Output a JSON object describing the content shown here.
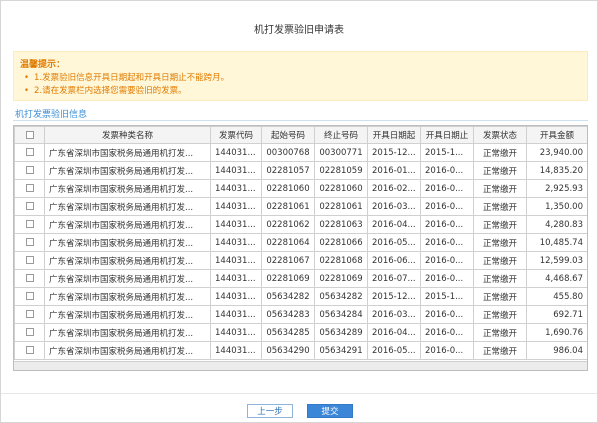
{
  "dialog": {
    "title": "机打发票验旧申请表"
  },
  "notice": {
    "heading": "温馨提示：",
    "items": [
      {
        "bullet": "•",
        "text": "1.发票验旧信息开具日期起和开具日期止不能跨月。"
      },
      {
        "bullet": "•",
        "text": "2.请在发票栏内选择您需要验旧的发票。"
      }
    ]
  },
  "section": {
    "label": "机打发票验旧信息"
  },
  "table": {
    "headers": {
      "type_name": "发票种类名称",
      "code": "发票代码",
      "start_no": "起始号码",
      "end_no": "终止号码",
      "date_from": "开具日期起",
      "date_to": "开具日期止",
      "status": "发票状态",
      "amount": "开具金额"
    },
    "rows": [
      {
        "type_name": "广东省深圳市国家税务局通用机打发...",
        "code": "144031...",
        "start_no": "00300768",
        "end_no": "00300771",
        "date_from": "2015-12...",
        "date_to": "2015-1...",
        "status": "正常缴开",
        "amount": "23,940.00"
      },
      {
        "type_name": "广东省深圳市国家税务局通用机打发...",
        "code": "144031...",
        "start_no": "02281057",
        "end_no": "02281059",
        "date_from": "2016-01...",
        "date_to": "2016-0...",
        "status": "正常缴开",
        "amount": "14,835.20"
      },
      {
        "type_name": "广东省深圳市国家税务局通用机打发...",
        "code": "144031...",
        "start_no": "02281060",
        "end_no": "02281060",
        "date_from": "2016-02...",
        "date_to": "2016-0...",
        "status": "正常缴开",
        "amount": "2,925.93"
      },
      {
        "type_name": "广东省深圳市国家税务局通用机打发...",
        "code": "144031...",
        "start_no": "02281061",
        "end_no": "02281061",
        "date_from": "2016-03...",
        "date_to": "2016-0...",
        "status": "正常缴开",
        "amount": "1,350.00"
      },
      {
        "type_name": "广东省深圳市国家税务局通用机打发...",
        "code": "144031...",
        "start_no": "02281062",
        "end_no": "02281063",
        "date_from": "2016-04...",
        "date_to": "2016-0...",
        "status": "正常缴开",
        "amount": "4,280.83"
      },
      {
        "type_name": "广东省深圳市国家税务局通用机打发...",
        "code": "144031...",
        "start_no": "02281064",
        "end_no": "02281066",
        "date_from": "2016-05...",
        "date_to": "2016-0...",
        "status": "正常缴开",
        "amount": "10,485.74"
      },
      {
        "type_name": "广东省深圳市国家税务局通用机打发...",
        "code": "144031...",
        "start_no": "02281067",
        "end_no": "02281068",
        "date_from": "2016-06...",
        "date_to": "2016-0...",
        "status": "正常缴开",
        "amount": "12,599.03"
      },
      {
        "type_name": "广东省深圳市国家税务局通用机打发...",
        "code": "144031...",
        "start_no": "02281069",
        "end_no": "02281069",
        "date_from": "2016-07...",
        "date_to": "2016-0...",
        "status": "正常缴开",
        "amount": "4,468.67"
      },
      {
        "type_name": "广东省深圳市国家税务局通用机打发...",
        "code": "144031...",
        "start_no": "05634282",
        "end_no": "05634282",
        "date_from": "2015-12...",
        "date_to": "2015-1...",
        "status": "正常缴开",
        "amount": "455.80"
      },
      {
        "type_name": "广东省深圳市国家税务局通用机打发...",
        "code": "144031...",
        "start_no": "05634283",
        "end_no": "05634284",
        "date_from": "2016-03...",
        "date_to": "2016-0...",
        "status": "正常缴开",
        "amount": "692.71"
      },
      {
        "type_name": "广东省深圳市国家税务局通用机打发...",
        "code": "144031...",
        "start_no": "05634285",
        "end_no": "05634289",
        "date_from": "2016-04...",
        "date_to": "2016-0...",
        "status": "正常缴开",
        "amount": "1,690.76"
      },
      {
        "type_name": "广东省深圳市国家税务局通用机打发...",
        "code": "144031...",
        "start_no": "05634290",
        "end_no": "05634291",
        "date_from": "2016-05...",
        "date_to": "2016-0...",
        "status": "正常缴开",
        "amount": "986.04"
      }
    ]
  },
  "buttons": {
    "prev": "上一步",
    "submit": "提交"
  }
}
